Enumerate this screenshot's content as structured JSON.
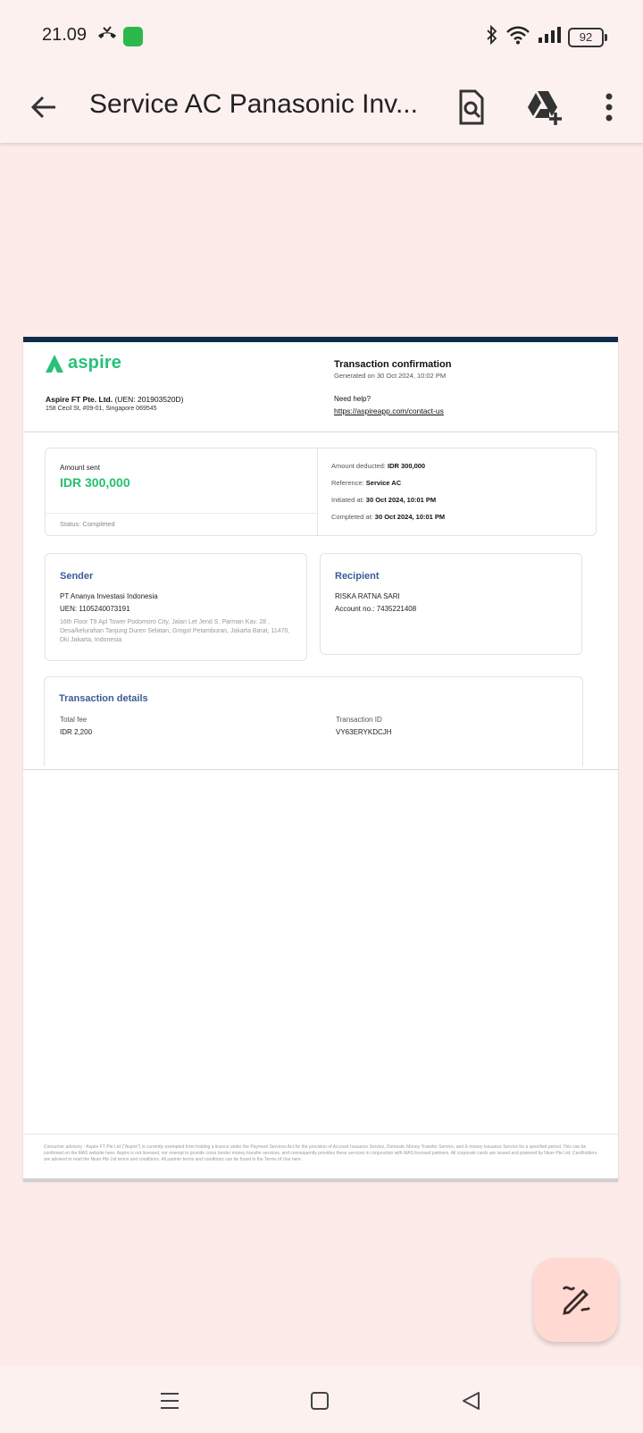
{
  "status_bar": {
    "time": "21.09",
    "battery": "92"
  },
  "app_bar": {
    "title": "Service AC Panasonic Inv..."
  },
  "document": {
    "brand": "aspire",
    "company_name": "Aspire FT Pte. Ltd.",
    "company_uen": "(UEN: 201903520D)",
    "company_address": "158 Cecil St, #09-01, Singapore 069545",
    "title": "Transaction confirmation",
    "generated": "Generated on 30 Oct 2024, 10:02 PM",
    "help_label": "Need help?",
    "help_link": "https://aspireapp.com/contact-us",
    "summary": {
      "amount_label": "Amount sent",
      "amount_value": "IDR 300,000",
      "status": "Status: Completed",
      "rows": [
        {
          "label": "Amount deducted:",
          "value": "IDR 300,000"
        },
        {
          "label": "Reference:",
          "value": "Service AC"
        },
        {
          "label": "Initiated at:",
          "value": "30 Oct 2024, 10:01 PM"
        },
        {
          "label": "Completed at:",
          "value": "30 Oct 2024, 10:01 PM"
        }
      ]
    },
    "sender": {
      "title": "Sender",
      "name": "PT Ananya Investasi Indonesia",
      "uen": "UEN: 1105240073191",
      "address": "16th Floor T9 Apl Tower Podomoro City, Jalan Let Jend S. Parman Kav. 28 , Desa/kelurahan Tanjung Duren Selatan, Grogol Petamburan, Jakarta Barat, 11470, Dki Jakarta, Indonesia"
    },
    "recipient": {
      "title": "Recipient",
      "name": "RISKA RATNA SARI",
      "account": "Account no.: 7435221408"
    },
    "details": {
      "title": "Transaction details",
      "fee_label": "Total fee",
      "fee_value": "IDR 2,200",
      "id_label": "Transaction ID",
      "id_value": "VY63ERYKDCJH"
    },
    "footer": "Consumer advisory - Aspire FT Pte Ltd (\"Aspire\") is currently exempted from holding a licence under the Payment Services Act for the provision of Account Issuance Service, Domestic Money Transfer Service, and E-money Issuance Service for a specified period. This can be confirmed on the MAS website here. Aspire is not licensed, nor exempt to provide cross border money transfer services, and consequently provides these services in conjunction with MAS licensed partners. All corporate cards are issued and powered by Nium Pte Ltd. Cardholders are advised to read the Nium Pte Ltd terms and conditions. All partner terms and conditions can be found in the Terms of Use here."
  },
  "colors": {
    "background": "#fcebe8",
    "accent_green": "#21c16b",
    "heading_blue": "#3a5c96",
    "doc_bar": "#0f2d4a"
  },
  "icons": [
    "call-missed-icon",
    "app-notification-icon",
    "bluetooth-icon",
    "wifi-icon",
    "signal-icon",
    "battery-icon",
    "back-arrow-icon",
    "doc-search-icon",
    "drive-add-icon",
    "more-vert-icon",
    "edit-pen-icon",
    "menu-icon",
    "home-icon",
    "back-icon"
  ]
}
